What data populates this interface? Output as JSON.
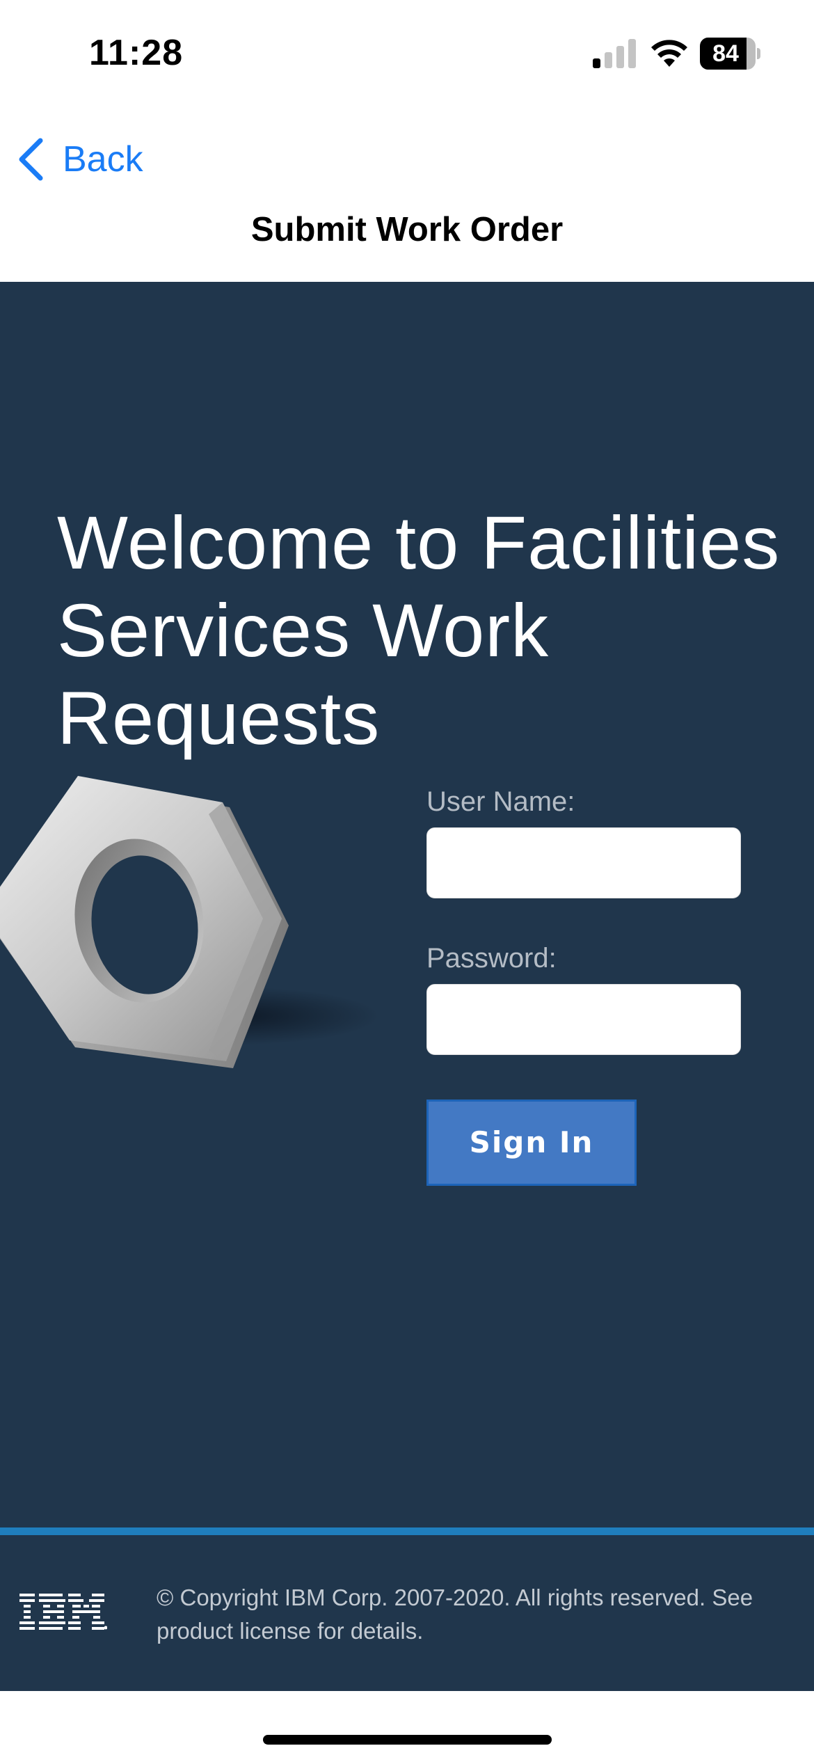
{
  "status_bar": {
    "time": "11:28",
    "battery_level": "84",
    "signal_icon": "cellular-signal-icon",
    "wifi_icon": "wifi-icon"
  },
  "nav": {
    "back_label": "Back",
    "title": "Submit Work Order",
    "accent_color": "#1a7cf6"
  },
  "login": {
    "welcome_heading": "Welcome to Facilities Services Work Requests",
    "username_label": "User Name:",
    "username_value": "",
    "password_label": "Password:",
    "password_value": "",
    "sign_in_label": "Sign In",
    "image": "hex-nut-icon",
    "background_color": "#20364c",
    "button_color": "#4379c4"
  },
  "footer": {
    "logo": "IBM",
    "copyright": "© Copyright IBM Corp. 2007-2020. All rights reserved. See product license for details.",
    "divider_color": "#1f7ebd"
  }
}
